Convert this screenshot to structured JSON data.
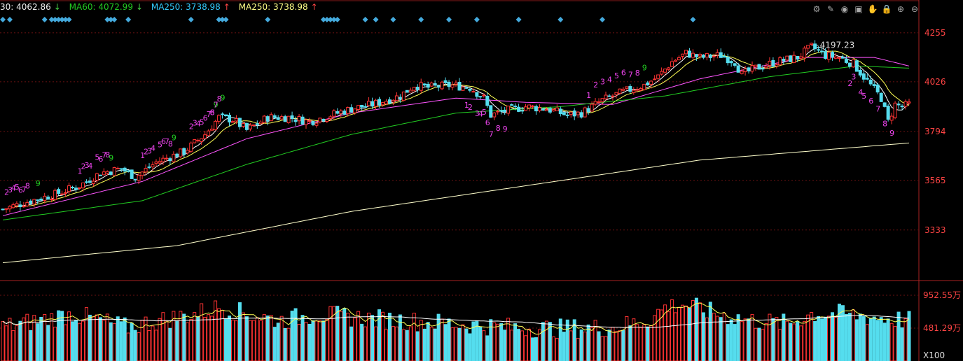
{
  "legend": {
    "ma30": {
      "label": "30: 4062.86",
      "arrow": "↓",
      "color": "#f0f0f0"
    },
    "ma60": {
      "label": "MA60: 4072.99",
      "arrow": "↓",
      "color": "#22cc22"
    },
    "ma250a": {
      "label": "MA250: 3738.98",
      "arrow": "↑",
      "color": "#33ccff"
    },
    "ma250b": {
      "label": "MA250: 3738.98",
      "arrow": "↑",
      "color": "#ffff88"
    }
  },
  "toolbar": {
    "icons": [
      "gear-icon",
      "pen-icon",
      "eye-icon",
      "image-icon",
      "hand-icon",
      "lock-icon",
      "zoom-in-icon",
      "zoom-out-icon"
    ],
    "glyphs": [
      "⚙",
      "✎",
      "◉",
      "▣",
      "✋",
      "🔒",
      "⊕",
      "⊖"
    ]
  },
  "chart_data": {
    "type": "candlestick",
    "price_axis": {
      "ticks": [
        "4255",
        "4026",
        "3794",
        "3565",
        "3333"
      ],
      "ylim": [
        3100,
        4330
      ]
    },
    "volume_axis": {
      "ticks": [
        "952.55万",
        "481.29万"
      ],
      "multiplier": "X100"
    },
    "high_annotation": "4197.23",
    "colors": {
      "up": "#ff3333",
      "down": "#55ddee",
      "ma5": "#ffffff",
      "ma10": "#ffff55",
      "ma20": "#ff55ff",
      "ma60": "#22cc22",
      "ma250": "#ffffcc",
      "marker": "#44aadd",
      "grid": "#6a1212"
    },
    "price_anchors": [
      [
        0,
        3430
      ],
      [
        8,
        3470
      ],
      [
        15,
        3500
      ],
      [
        22,
        3540
      ],
      [
        28,
        3600
      ],
      [
        34,
        3620
      ],
      [
        38,
        3580
      ],
      [
        44,
        3650
      ],
      [
        52,
        3700
      ],
      [
        58,
        3780
      ],
      [
        62,
        3860
      ],
      [
        66,
        3850
      ],
      [
        70,
        3800
      ],
      [
        76,
        3860
      ],
      [
        82,
        3860
      ],
      [
        88,
        3840
      ],
      [
        94,
        3870
      ],
      [
        100,
        3900
      ],
      [
        106,
        3920
      ],
      [
        110,
        3940
      ],
      [
        114,
        3960
      ],
      [
        118,
        4010
      ],
      [
        122,
        4000
      ],
      [
        128,
        4010
      ],
      [
        134,
        4000
      ],
      [
        138,
        3950
      ],
      [
        140,
        3870
      ],
      [
        144,
        3890
      ],
      [
        150,
        3910
      ],
      [
        156,
        3900
      ],
      [
        162,
        3870
      ],
      [
        166,
        3880
      ],
      [
        172,
        3940
      ],
      [
        178,
        3980
      ],
      [
        184,
        4010
      ],
      [
        188,
        4050
      ],
      [
        192,
        4120
      ],
      [
        196,
        4160
      ],
      [
        200,
        4140
      ],
      [
        206,
        4150
      ],
      [
        210,
        4120
      ],
      [
        212,
        4060
      ],
      [
        216,
        4090
      ],
      [
        222,
        4120
      ],
      [
        228,
        4140
      ],
      [
        232,
        4190
      ],
      [
        236,
        4150
      ],
      [
        240,
        4140
      ],
      [
        244,
        4110
      ],
      [
        248,
        4030
      ],
      [
        252,
        3950
      ],
      [
        254,
        3840
      ],
      [
        256,
        3920
      ],
      [
        258,
        3910
      ],
      [
        260,
        3920
      ]
    ],
    "ma250_anchors": [
      [
        0,
        3180
      ],
      [
        50,
        3260
      ],
      [
        100,
        3420
      ],
      [
        150,
        3540
      ],
      [
        200,
        3660
      ],
      [
        260,
        3740
      ]
    ],
    "ma60_anchors": [
      [
        0,
        3380
      ],
      [
        40,
        3470
      ],
      [
        70,
        3640
      ],
      [
        100,
        3780
      ],
      [
        130,
        3880
      ],
      [
        160,
        3910
      ],
      [
        190,
        3960
      ],
      [
        220,
        4050
      ],
      [
        245,
        4100
      ],
      [
        260,
        4090
      ]
    ],
    "ma20_anchors": [
      [
        0,
        3400
      ],
      [
        40,
        3560
      ],
      [
        70,
        3760
      ],
      [
        100,
        3880
      ],
      [
        130,
        3950
      ],
      [
        150,
        3930
      ],
      [
        175,
        3920
      ],
      [
        200,
        4040
      ],
      [
        230,
        4140
      ],
      [
        250,
        4140
      ],
      [
        260,
        4100
      ]
    ],
    "volume_anchors": [
      [
        0,
        5
      ],
      [
        10,
        6
      ],
      [
        20,
        7
      ],
      [
        28,
        6
      ],
      [
        35,
        5
      ],
      [
        45,
        6
      ],
      [
        55,
        7
      ],
      [
        62,
        8
      ],
      [
        70,
        7
      ],
      [
        80,
        6
      ],
      [
        90,
        7
      ],
      [
        100,
        6.5
      ],
      [
        115,
        6
      ],
      [
        130,
        5.5
      ],
      [
        145,
        5
      ],
      [
        160,
        4.8
      ],
      [
        175,
        5
      ],
      [
        185,
        6
      ],
      [
        190,
        8
      ],
      [
        195,
        8.5
      ],
      [
        205,
        7
      ],
      [
        215,
        6
      ],
      [
        225,
        5.5
      ],
      [
        232,
        7
      ],
      [
        240,
        7
      ],
      [
        250,
        6.5
      ],
      [
        260,
        6
      ]
    ],
    "volume_max": 10,
    "up_counts": [
      {
        "i": 1,
        "t": "2"
      },
      {
        "i": 2,
        "t": "3"
      },
      {
        "i": 3,
        "t": "4"
      },
      {
        "i": 4,
        "t": "5"
      },
      {
        "i": 5,
        "t": "6"
      },
      {
        "i": 6,
        "t": "7"
      },
      {
        "i": 7,
        "t": "8"
      },
      {
        "i": 10,
        "t": "9",
        "g": true
      },
      {
        "i": 22,
        "t": "1"
      },
      {
        "i": 23,
        "t": "2"
      },
      {
        "i": 24,
        "t": "3"
      },
      {
        "i": 25,
        "t": "4"
      },
      {
        "i": 27,
        "t": "5"
      },
      {
        "i": 28,
        "t": "6"
      },
      {
        "i": 29,
        "t": "7"
      },
      {
        "i": 30,
        "t": "8"
      },
      {
        "i": 31,
        "t": "9",
        "g": true
      },
      {
        "i": 40,
        "t": "1"
      },
      {
        "i": 41,
        "t": "2"
      },
      {
        "i": 42,
        "t": "3"
      },
      {
        "i": 43,
        "t": "4"
      },
      {
        "i": 45,
        "t": "5"
      },
      {
        "i": 46,
        "t": "6"
      },
      {
        "i": 47,
        "t": "7"
      },
      {
        "i": 48,
        "t": "8"
      },
      {
        "i": 49,
        "t": "9",
        "g": true
      },
      {
        "i": 54,
        "t": "2"
      },
      {
        "i": 55,
        "t": "3"
      },
      {
        "i": 56,
        "t": "4"
      },
      {
        "i": 57,
        "t": "5"
      },
      {
        "i": 58,
        "t": "6"
      },
      {
        "i": 59,
        "t": "7"
      },
      {
        "i": 60,
        "t": "8"
      },
      {
        "i": 61,
        "t": "9",
        "g": true
      },
      {
        "i": 60,
        "t": "6"
      },
      {
        "i": 61,
        "t": "7"
      },
      {
        "i": 62,
        "t": "8"
      },
      {
        "i": 63,
        "t": "9",
        "g": true
      },
      {
        "i": 168,
        "t": "1"
      },
      {
        "i": 170,
        "t": "2"
      },
      {
        "i": 172,
        "t": "3"
      },
      {
        "i": 174,
        "t": "4"
      },
      {
        "i": 176,
        "t": "5"
      },
      {
        "i": 178,
        "t": "6"
      },
      {
        "i": 180,
        "t": "7"
      },
      {
        "i": 182,
        "t": "8"
      },
      {
        "i": 184,
        "t": "9",
        "g": true
      }
    ],
    "down_counts": [
      {
        "i": 133,
        "t": "1"
      },
      {
        "i": 134,
        "t": "2"
      },
      {
        "i": 136,
        "t": "3"
      },
      {
        "i": 137,
        "t": "4"
      },
      {
        "i": 138,
        "t": "5"
      },
      {
        "i": 139,
        "t": "6"
      },
      {
        "i": 140,
        "t": "7"
      },
      {
        "i": 142,
        "t": "8"
      },
      {
        "i": 144,
        "t": "9"
      },
      {
        "i": 243,
        "t": "2"
      },
      {
        "i": 244,
        "t": "3"
      },
      {
        "i": 246,
        "t": "4"
      },
      {
        "i": 247,
        "t": "5"
      },
      {
        "i": 249,
        "t": "6"
      },
      {
        "i": 251,
        "t": "7"
      },
      {
        "i": 253,
        "t": "8"
      },
      {
        "i": 255,
        "t": "9"
      }
    ],
    "markers": [
      0,
      2,
      12,
      14,
      15,
      16,
      17,
      18,
      19,
      30,
      31,
      32,
      36,
      54,
      62,
      63,
      64,
      76,
      92,
      93,
      94,
      95,
      96,
      104,
      107,
      112,
      120,
      128,
      136,
      148,
      160,
      172,
      198
    ]
  }
}
